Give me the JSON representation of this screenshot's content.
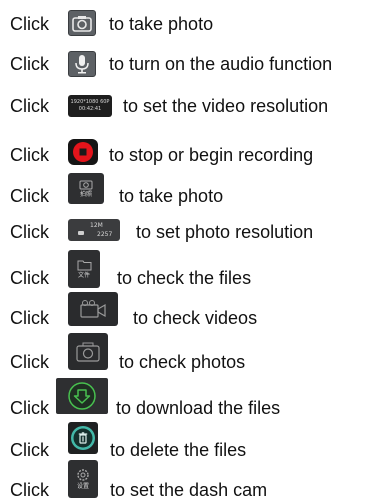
{
  "click_word": "Click",
  "rows": [
    {
      "icon": "camera-icon",
      "text": "to take photo"
    },
    {
      "icon": "microphone-icon",
      "text": "to turn on the audio function"
    },
    {
      "icon": "video-resolution-icon",
      "text": "to set the video resolution",
      "icon_text": [
        "1920*1080 60P",
        "00:42:41"
      ]
    },
    {
      "icon": "record-icon",
      "text": "to stop or begin recording"
    },
    {
      "icon": "camera-icon",
      "text": "to take photo",
      "icon_text": [
        "拍照"
      ]
    },
    {
      "icon": "photo-resolution-icon",
      "text": "to set photo resolution",
      "icon_text": [
        "12M",
        "2257"
      ]
    },
    {
      "icon": "folder-icon",
      "text": "to check the files",
      "icon_text": [
        "文件"
      ]
    },
    {
      "icon": "video-camera-icon",
      "text": "to check videos"
    },
    {
      "icon": "camera-icon",
      "text": "to check photos"
    },
    {
      "icon": "download-icon",
      "text": "to download the files"
    },
    {
      "icon": "trash-icon",
      "text": "to delete the files"
    },
    {
      "icon": "settings-icon",
      "text": "to set the dash cam",
      "icon_text": [
        "设置"
      ]
    }
  ]
}
